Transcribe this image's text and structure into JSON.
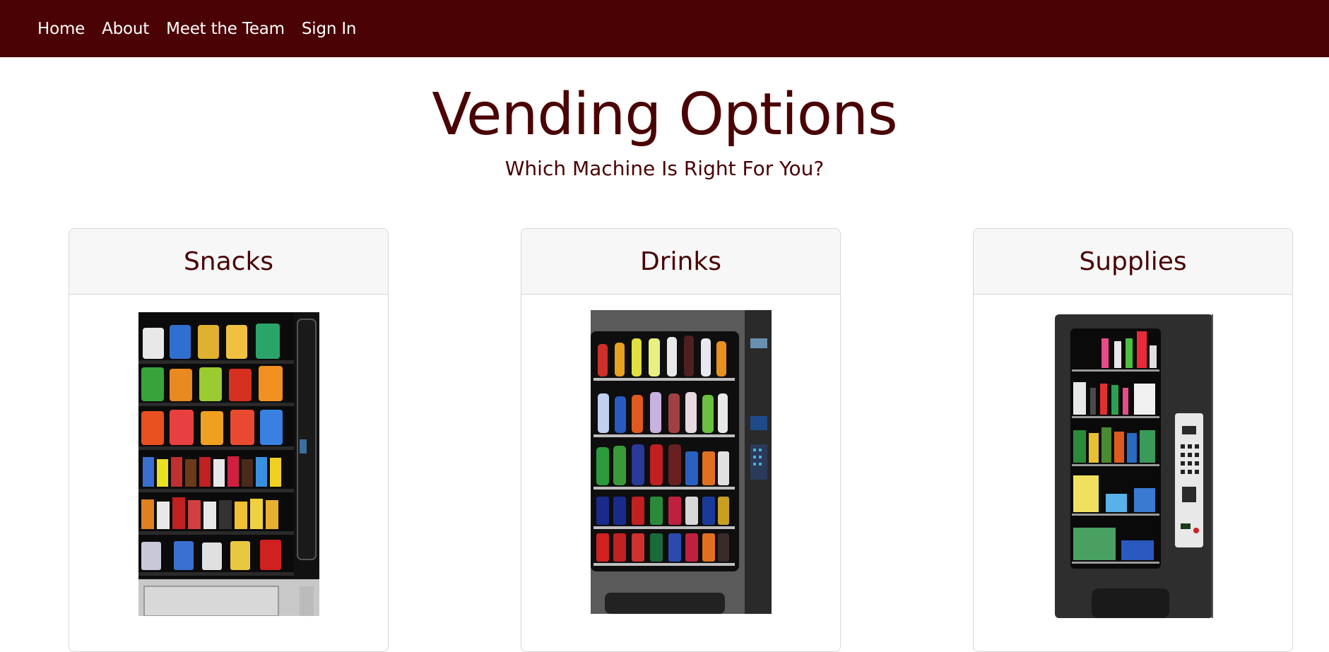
{
  "nav": {
    "items": [
      {
        "label": "Home"
      },
      {
        "label": "About"
      },
      {
        "label": "Meet the Team"
      },
      {
        "label": "Sign In"
      }
    ]
  },
  "hero": {
    "title": "Vending Options",
    "subtitle": "Which Machine Is Right For You?"
  },
  "cards": [
    {
      "title": "Snacks",
      "image": "snack-vending-machine-image"
    },
    {
      "title": "Drinks",
      "image": "drink-vending-machine-image"
    },
    {
      "title": "Supplies",
      "image": "supplies-vending-machine-image"
    }
  ],
  "colors": {
    "brand": "#4a0204",
    "nav_text": "#ffffff",
    "card_header_bg": "#f7f7f7",
    "card_border": "#d7d7d7"
  }
}
